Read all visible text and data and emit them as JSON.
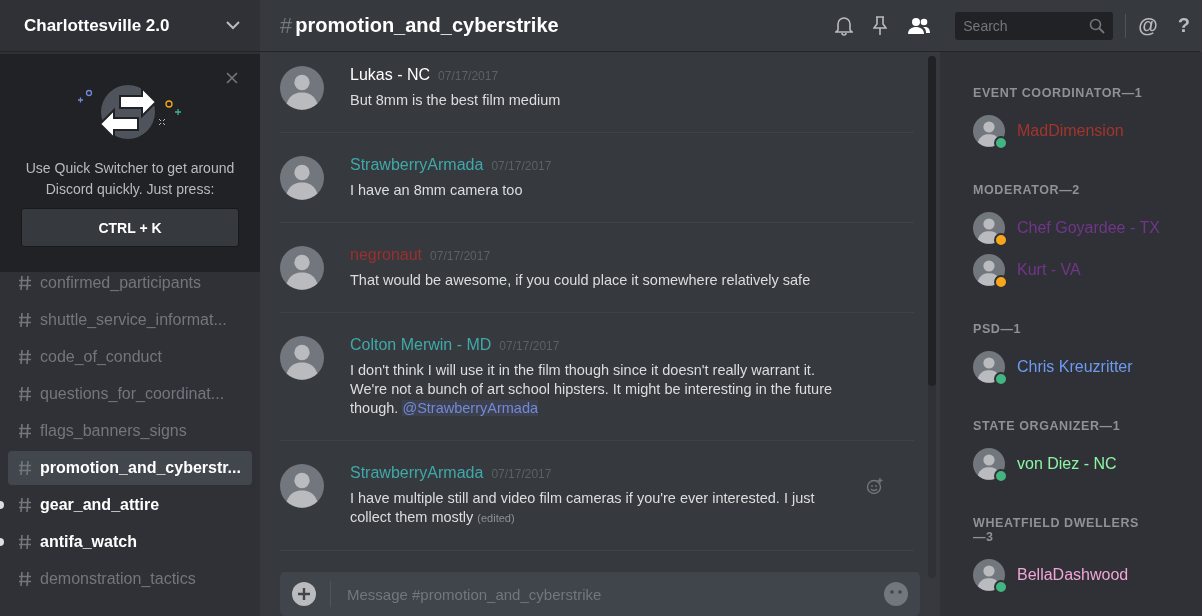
{
  "server": {
    "name": "Charlottesville 2.0"
  },
  "quick_switcher": {
    "text": "Use Quick Switcher to get around Discord quickly. Just press:",
    "shortcut": "CTRL + K"
  },
  "channels": [
    {
      "name": "confirmed_participants",
      "selected": false,
      "unread": false
    },
    {
      "name": "shuttle_service_informat...",
      "selected": false,
      "unread": false
    },
    {
      "name": "code_of_conduct",
      "selected": false,
      "unread": false
    },
    {
      "name": "questions_for_coordinat...",
      "selected": false,
      "unread": false
    },
    {
      "name": "flags_banners_signs",
      "selected": false,
      "unread": false
    },
    {
      "name": "promotion_and_cyberstr...",
      "selected": true,
      "unread": false
    },
    {
      "name": "gear_and_attire",
      "selected": false,
      "unread": true
    },
    {
      "name": "antifa_watch",
      "selected": false,
      "unread": true
    },
    {
      "name": "demonstration_tactics",
      "selected": false,
      "unread": false
    }
  ],
  "header": {
    "hash": "#",
    "channel": "promotion_and_cyberstrike",
    "search_placeholder": "Search",
    "mention_button": "@",
    "help_button": "?"
  },
  "messages": [
    {
      "author": "Lukas - NC",
      "color": "#ffffff",
      "time": "07/17/2017",
      "text": "But 8mm is the best film medium",
      "hovered": false
    },
    {
      "author": "StrawberryArmada",
      "color": "#3fa9a9",
      "time": "07/17/2017",
      "text": "I have an 8mm camera too",
      "hovered": false
    },
    {
      "author": "negronaut",
      "color": "#9a3030",
      "time": "07/17/2017",
      "text": "That would be awesome, if you could place it somewhere relatively safe",
      "hovered": false
    },
    {
      "author": "Colton Merwin - MD",
      "color": "#3fa9a9",
      "time": "07/17/2017",
      "text": "I don't think I will use it in the film though since it doesn't really warrant it. We're not a bunch of art school hipsters. It might be interesting in the future though.",
      "mention": "@StrawberryArmada",
      "hovered": false
    },
    {
      "author": "StrawberryArmada",
      "color": "#3fa9a9",
      "time": "07/17/2017",
      "text": "I have multiple still and video film cameras if you're ever interested. I just collect them mostly",
      "edited": "(edited)",
      "hovered": true
    }
  ],
  "composer": {
    "placeholder": "Message #promotion_and_cyberstrike"
  },
  "member_groups": [
    {
      "heading": "EVENT COORDINATOR—1",
      "members": [
        {
          "name": "MadDimension",
          "color": "#a4342c",
          "status": {
            "color": "#43b581"
          }
        }
      ]
    },
    {
      "heading": "MODERATOR—2",
      "members": [
        {
          "name": "Chef Goyardee - TX",
          "color": "#71368a",
          "status": {
            "color": "#faa61a"
          }
        },
        {
          "name": "Kurt - VA",
          "color": "#71368a",
          "status": {
            "color": "#faa61a"
          }
        }
      ]
    },
    {
      "heading": "PSD—1",
      "members": [
        {
          "name": "Chris Kreuzritter",
          "color": "#6d9bf1",
          "status": {
            "color": "#43b581"
          }
        }
      ]
    },
    {
      "heading": "STATE ORGANIZER—1",
      "members": [
        {
          "name": "von Diez - NC",
          "color": "#8cf5a3",
          "status": {
            "color": "#43b581"
          }
        }
      ]
    },
    {
      "heading": "WHEATFIELD DWELLERS—3",
      "members": [
        {
          "name": "BellaDashwood",
          "color": "#f1a6d6",
          "status": {
            "color": "#43b581"
          }
        }
      ]
    }
  ]
}
